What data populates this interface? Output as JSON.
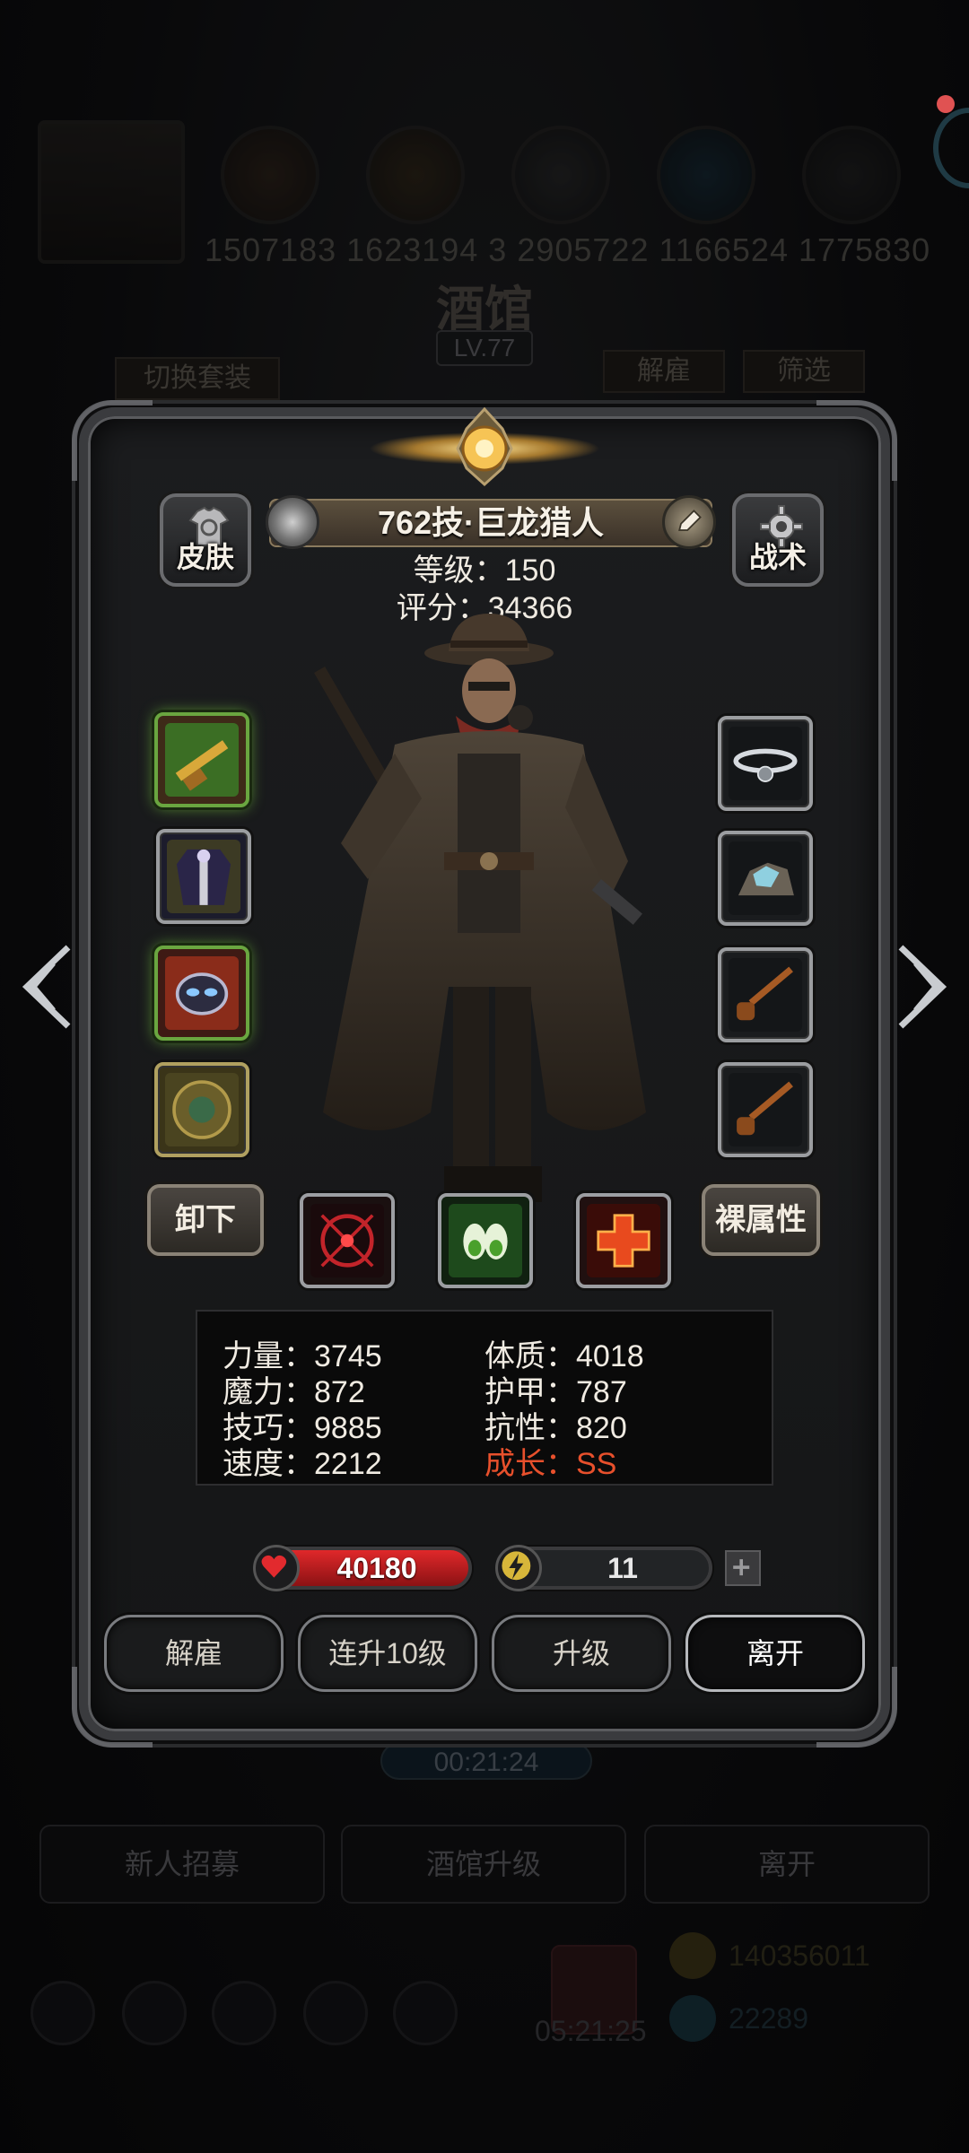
{
  "background": {
    "player_ids": "1507183 1623194 3 2905722 1166524 1775830",
    "title": "酒馆",
    "level": "LV.77",
    "switch_outfit": "切换套装",
    "dismiss": "解雇",
    "filter": "筛选",
    "timer": "00:21:24",
    "recruit": "新人招募",
    "tavern_upgrade": "酒馆升级",
    "leave": "离开",
    "gift_timer": "05:21:25",
    "gold": "140356011",
    "gems": "22289"
  },
  "hero": {
    "skin_label": "皮肤",
    "tactics_label": "战术",
    "name": "762技·巨龙猎人",
    "level_text": "等级：150",
    "score_text": "评分：34366",
    "level": 150,
    "score": 34366
  },
  "equipment": {
    "left": [
      {
        "icon": "shotgun-icon"
      },
      {
        "icon": "coat-armor-icon"
      },
      {
        "icon": "mask-helmet-icon"
      },
      {
        "icon": "round-shield-icon"
      }
    ],
    "right": [
      {
        "icon": "amulet-icon"
      },
      {
        "icon": "crystal-ore-icon"
      },
      {
        "icon": "pipe-icon"
      },
      {
        "icon": "pipe-icon"
      }
    ]
  },
  "actions": {
    "unequip": "卸下",
    "base_attributes": "裸属性",
    "skills": [
      {
        "icon": "target-skill-icon"
      },
      {
        "icon": "claw-skill-icon"
      },
      {
        "icon": "cross-skill-icon"
      }
    ]
  },
  "attributes": {
    "strength": "力量：3745",
    "constitution": "体质：4018",
    "magic": "魔力：872",
    "armor": "护甲：787",
    "skill": "技巧：9885",
    "resistance": "抗性：820",
    "speed": "速度：2212",
    "growth": "成长：SS"
  },
  "status": {
    "hp": "40180",
    "energy": "11",
    "energy_fraction": 0.12
  },
  "buttons": {
    "dismiss": "解雇",
    "level_up_10": "连升10级",
    "level_up": "升级",
    "leave": "离开"
  },
  "colors": {
    "growth_red": "#e8502c",
    "hp_red": "#d42427",
    "energy_yellow": "#d9c13a"
  }
}
